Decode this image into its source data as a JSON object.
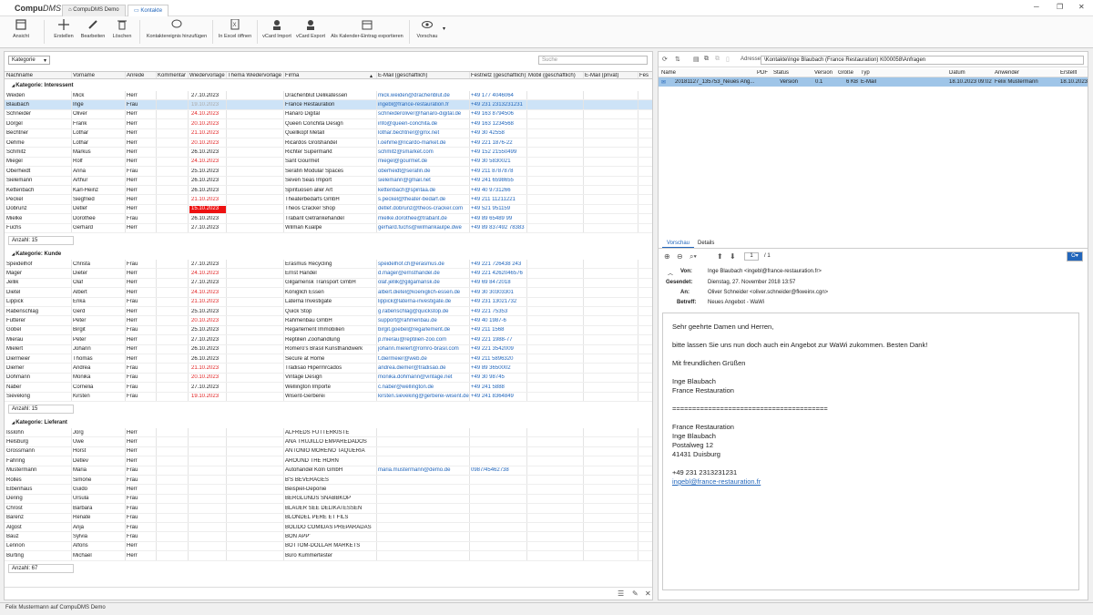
{
  "app": {
    "title": "CompuDMS",
    "tabs": [
      "CompuDMS Demo",
      "Kontakte"
    ]
  },
  "ribbon": {
    "buttons": [
      "Ansicht",
      "Erstellen",
      "Bearbeiten",
      "Löschen",
      "Kontaktereignis hinzufügen",
      "In Excel öffnen",
      "vCard Import",
      "vCard Export",
      "Als Kalender-Eintrag exportieren",
      "Vorschau"
    ]
  },
  "grid": {
    "group_by": "Kategorie",
    "search_placeholder": "Suche",
    "columns": [
      "Nachname",
      "Vorname",
      "Anrede",
      "Kommentar",
      "Wiedervorlage",
      "Thema Wiedervorlage",
      "Firma",
      "E-Mail (geschäftlich)",
      "Festnetz (geschäftlich)",
      "Mobil (geschäftlich)",
      "E-Mail (privat)",
      "Fes"
    ],
    "groups": [
      {
        "label": "Kategorie: Interessent",
        "count": "Anzahl: 15",
        "rows": [
          [
            "Weiden",
            "Mick",
            "Herr",
            "27.10.2023",
            "n",
            "Drachenblut Delikatessen",
            "mick.weiden@drachenblut.de",
            "+49 177 4046064"
          ],
          [
            "Blaubach",
            "Inge",
            "Frau",
            "19.10.2023",
            "g",
            "France Restauration",
            "ingebl@france-restauration.fr",
            "+49 231 2313231231"
          ],
          [
            "Schneider",
            "Oliver",
            "Herr",
            "24.10.2023",
            "r",
            "Hanaro Digital",
            "schneideroliver@hanaro-digital.de",
            "+49 163 8794506"
          ],
          [
            "Dörgel",
            "Frank",
            "Herr",
            "20.10.2023",
            "r",
            "Queen Conchita Design",
            "info@queen-conchita.de",
            "+49 163 1234568"
          ],
          [
            "Bechtner",
            "Lothar",
            "Herr",
            "21.10.2023",
            "r",
            "Quellkopf Metall",
            "lothar.bechtner@gmx.net",
            "+49 30 42558"
          ],
          [
            "Oehme",
            "Lothar",
            "Herr",
            "20.10.2023",
            "r",
            "Ricardos Großhandel",
            "l.oehme@ricardo-market.de",
            "+49 221 1876-22"
          ],
          [
            "Schmitz",
            "Markus",
            "Herr",
            "26.10.2023",
            "n",
            "Richter Supermarkt",
            "schmitz@smarket.com",
            "+49 152 21550499"
          ],
          [
            "Miegel",
            "Rolf",
            "Herr",
            "24.10.2023",
            "r",
            "Sant Gourmet",
            "miegel@gourmet.de",
            "+49 30 5830021"
          ],
          [
            "Oberheidt",
            "Anna",
            "Frau",
            "25.10.2023",
            "n",
            "Serafin Modular Spaces",
            "oberheidt@serafin.de",
            "+49 211 8787878"
          ],
          [
            "Sielemann",
            "Arthur",
            "Herr",
            "26.10.2023",
            "n",
            "Seven Seas Import",
            "sielemann@gmail.net",
            "+49 241 6598655"
          ],
          [
            "Kettenbach",
            "Karl-Heinz",
            "Herr",
            "26.10.2023",
            "n",
            "Spirituosen aller Art",
            "kettenbach@spiritaa.de",
            "+49 40 9731266"
          ],
          [
            "Peckel",
            "Siegfried",
            "Herr",
            "21.10.2023",
            "r",
            "Theaterbedarfs GmbH",
            "s.peckel@theater-bedarf.de",
            "+49 211 11211221"
          ],
          [
            "Dobrunz",
            "Detlef",
            "Herr",
            "15.10.2023",
            "b",
            "Theos Cracker Shop",
            "detlef.dobrunz@theos-cracker.com",
            "+49 521 951159"
          ],
          [
            "Mielke",
            "Dorothee",
            "Frau",
            "26.10.2023",
            "n",
            "Trabant Getränkehandel",
            "mielke.dorothee@trabant.de",
            "+49 89 65489 99"
          ],
          [
            "Fuchs",
            "Gerhard",
            "Herr",
            "27.10.2023",
            "n",
            "Wilman Kualpe",
            "gerhard.fuchs@wilmankaulpe.dwe",
            "+49 89 837492 78383"
          ]
        ]
      },
      {
        "label": "Kategorie: Kunde",
        "count": "Anzahl: 15",
        "rows": [
          [
            "Speidelhof",
            "Christa",
            "Frau",
            "27.10.2023",
            "n",
            "Erasmus Recycling",
            "speidelhof.ch@erasmus.de",
            "+49 221 726438 243"
          ],
          [
            "Mager",
            "Dieter",
            "Herr",
            "24.10.2023",
            "r",
            "Ernst Handel",
            "d.mager@ernsthandel.de",
            "+49 221 4262046576"
          ],
          [
            "Jellik",
            "Olaf",
            "Herr",
            "27.10.2023",
            "n",
            "Gilgamensk Transport GmbH",
            "olaf.jellik@gilgamansk.de",
            "+49 69 8472018"
          ],
          [
            "Dietel",
            "Albert",
            "Herr",
            "24.10.2023",
            "r",
            "Königlich Essen",
            "albert.dietel@koeniglich-essen.de",
            "+49 30 30303301"
          ],
          [
            "Lippick",
            "Erika",
            "Frau",
            "21.10.2023",
            "r",
            "Laterna Investigate",
            "lippick@laterna-investigate.de",
            "+49 231 13021732"
          ],
          [
            "Rabenschlag",
            "Gerd",
            "Herr",
            "25.10.2023",
            "n",
            "Quick Stop",
            "g.rabenschlag@quickstop.de",
            "+49 221 75353"
          ],
          [
            "Futterer",
            "Peter",
            "Herr",
            "20.10.2023",
            "r",
            "Rahmenbau GmbH",
            "support@rahmenbau.de",
            "+49 40 1987-6"
          ],
          [
            "Göbel",
            "Birgit",
            "Frau",
            "25.10.2023",
            "n",
            "Regarlement Immobilien",
            "birgit.goebel@regarlement.de",
            "+49 211 1568"
          ],
          [
            "Mierau",
            "Peter",
            "Herr",
            "27.10.2023",
            "n",
            "Reptilien Zoohandlung",
            "p.mierau@reptilien-zoo.com",
            "+49 221 1988-77"
          ],
          [
            "Mielert",
            "Johann",
            "Herr",
            "26.10.2023",
            "n",
            "Romero's Brasil Kunsthandwerk",
            "johann.mielert@romro-brasil.com",
            "+49 221 3542009"
          ],
          [
            "Diermeier",
            "Thomas",
            "Herr",
            "26.10.2023",
            "n",
            "Secure at Home",
            "t.diermeier@web.de",
            "+49 211 5896320"
          ],
          [
            "Diemer",
            "Andrea",
            "Frau",
            "21.10.2023",
            "r",
            "Tradisao Hipermrcados",
            "andrea.diemer@tradisao.de",
            "+49 89 3650002"
          ],
          [
            "Dohmann",
            "Monika",
            "Frau",
            "20.10.2023",
            "r",
            "Vintage Design",
            "monika.dohmann@vintage.net",
            "+49 30 98745"
          ],
          [
            "Naber",
            "Cornelia",
            "Frau",
            "27.10.2023",
            "n",
            "Wellington Importe",
            "c.naber@wellington.de",
            "+49 241 5888"
          ],
          [
            "Sieveking",
            "Kirsten",
            "Frau",
            "19.10.2023",
            "r",
            "Wisent-Gerberei",
            "kirsten.sieveking@gerberei-wisent.de",
            "+49 241 8364849"
          ]
        ]
      },
      {
        "label": "Kategorie: Lieferant",
        "count": "Anzahl: 67",
        "rows": [
          [
            "Isslohn",
            "Jörg",
            "Herr",
            "",
            "n",
            "ALFREDS FUTTERKISTE",
            "",
            ""
          ],
          [
            "Helsburg",
            "Uwe",
            "Herr",
            "",
            "n",
            "ANA TRUJILLO EMPAREDADOS",
            "",
            ""
          ],
          [
            "Grossmann",
            "Horst",
            "Herr",
            "",
            "n",
            "ANTONIO MORENO TAQUERÍA",
            "",
            ""
          ],
          [
            "Fahring",
            "Detlev",
            "Herr",
            "",
            "n",
            "AROUND THE HORN",
            "",
            ""
          ],
          [
            "Mustermann",
            "Maria",
            "Frau",
            "",
            "n",
            "Autohandel Köln GmbH",
            "maria.mustermann@demo.de",
            "0987/45462738"
          ],
          [
            "Rolles",
            "Simone",
            "Frau",
            "",
            "n",
            "B'S BEVERAGES",
            "",
            ""
          ],
          [
            "Elbenhaus",
            "Guido",
            "Herr",
            "",
            "n",
            "Beispiel-Deponie",
            "",
            ""
          ],
          [
            "Dering",
            "Ursula",
            "Frau",
            "",
            "n",
            "BERGLUNDS SNABBKÖP",
            "",
            ""
          ],
          [
            "Chrost",
            "Barbara",
            "Frau",
            "",
            "n",
            "BLAUER SEE DELIKATESSEN",
            "",
            ""
          ],
          [
            "Barenz",
            "Renate",
            "Frau",
            "",
            "n",
            "BLONDEL PERE ET FILS",
            "",
            ""
          ],
          [
            "Algost",
            "Anja",
            "Frau",
            "",
            "n",
            "BOLIDO COMIDAS PREPARADAS",
            "",
            ""
          ],
          [
            "Bauz",
            "Sylvia",
            "Frau",
            "",
            "n",
            "BON APP'",
            "",
            ""
          ],
          [
            "Lennon",
            "Alfons",
            "Herr",
            "",
            "n",
            "BOTTOM-DOLLAR MARKETS",
            "",
            ""
          ],
          [
            "Burting",
            "Michael",
            "Herr",
            "",
            "n",
            "Büro Kummertester",
            "",
            ""
          ]
        ]
      }
    ]
  },
  "preview": {
    "address_label": "Adresse",
    "address": "\\Kontakte\\Inge Blaubach (France Restauration)  K000058\\Anfragen",
    "doc_columns": [
      "Name",
      "PDF",
      "Status",
      "Version",
      "Größe",
      "Typ",
      "Datum",
      "Anwender",
      "Erstellt"
    ],
    "doc_row": {
      "name": "20181127_135753_Neues Ang...",
      "status": "Version",
      "version": "0.1",
      "size": "6 KB",
      "type": "E-Mail",
      "date": "18.10.2023 09:02",
      "user": "Felix Mustermann",
      "created": "18.10.2023"
    },
    "tabs": [
      "Vorschau",
      "Details"
    ],
    "page": "1",
    "page_total": "/ 1",
    "mail": {
      "from_label": "Von:",
      "from": "Inge Blaubach <ingebl@france-restauration.fr>",
      "sent_label": "Gesendet:",
      "sent": "Dienstag, 27. November 2018 13:57",
      "to_label": "An:",
      "to": "Oliver Schneider <oliver.schneider@fkweinx.cgn>",
      "subject_label": "Betreff:",
      "subject": "Neues Angebot - WaWi",
      "greeting": "Sehr geehrte Damen und Herren,",
      "body": "bitte lassen Sie uns nun doch auch ein Angebot zur WaWi zukommen. Besten Dank!",
      "closing": "Mit freundlichen Grüßen",
      "sig1": "Inge Blaubach",
      "sig2": "France Restauration",
      "divider": "=======================================",
      "addr1": "France Restauration",
      "addr2": "Inge Blaubach",
      "addr3": "Postalweg 12",
      "addr4": "41431 Duisburg",
      "phone": "+49 231 2313231231",
      "email": "ingebl@france-restauration.fr"
    }
  },
  "status": "Felix Mustermann auf CompuDMS Demo"
}
